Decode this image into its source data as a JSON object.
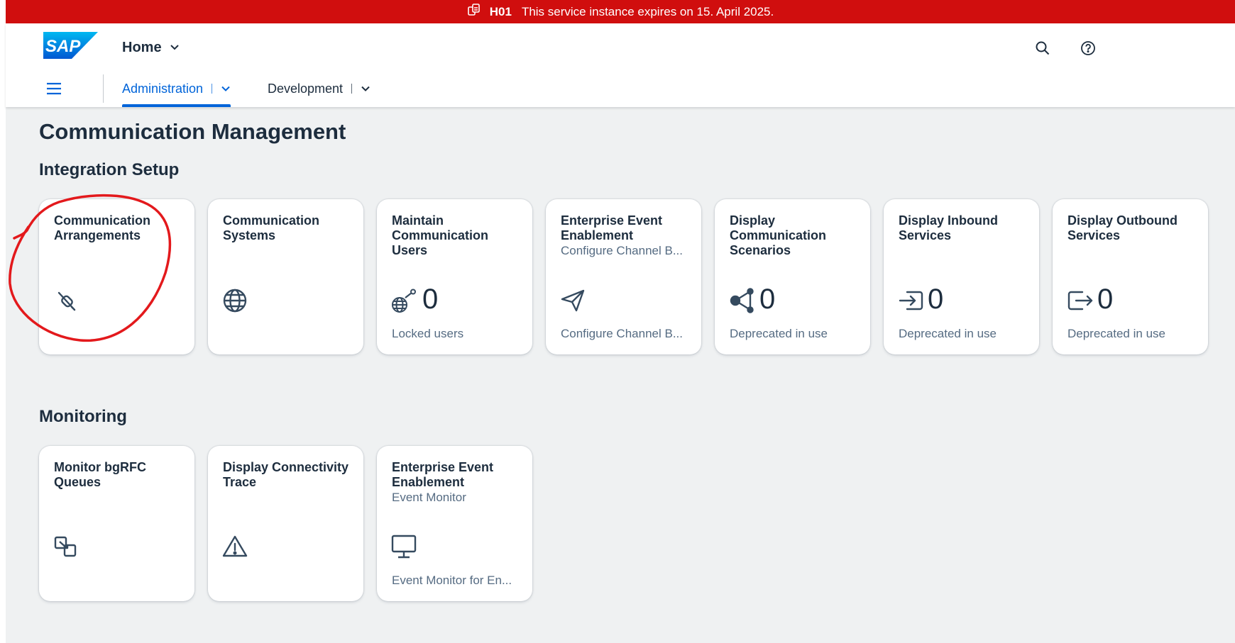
{
  "banner": {
    "system_id": "H01",
    "message": "This service instance expires on 15. April 2025.",
    "color": "#d00e0e"
  },
  "shell": {
    "logo_text": "SAP",
    "home_label": "Home",
    "actions": [
      "search-icon",
      "help-icon"
    ],
    "nav_tabs": [
      {
        "label": "Administration",
        "active": true
      },
      {
        "label": "Development",
        "active": false
      }
    ],
    "accent_color": "#0064d9"
  },
  "page": {
    "title": "Communication Management"
  },
  "sections": [
    {
      "title": "Integration Setup",
      "tiles": [
        {
          "title": "Communication Arrangements",
          "subtitle": "",
          "icon": "disconnected-icon",
          "number": "",
          "footer": ""
        },
        {
          "title": "Communication Systems",
          "subtitle": "",
          "icon": "globe-icon",
          "number": "",
          "footer": ""
        },
        {
          "title": "Maintain Communication Users",
          "subtitle": "",
          "icon": "user-globe-icon",
          "number": "0",
          "footer": "Locked users"
        },
        {
          "title": "Enterprise Event Enablement",
          "subtitle": "Configure Channel B...",
          "icon": "paper-plane-icon",
          "number": "",
          "footer": "Configure Channel B..."
        },
        {
          "title": "Display Communication Scenarios",
          "subtitle": "",
          "icon": "share-network-icon",
          "number": "0",
          "footer": "Deprecated in use"
        },
        {
          "title": "Display Inbound Services",
          "subtitle": "",
          "icon": "inbound-icon",
          "number": "0",
          "footer": "Deprecated in use"
        },
        {
          "title": "Display Outbound Services",
          "subtitle": "",
          "icon": "outbound-icon",
          "number": "0",
          "footer": "Deprecated in use"
        }
      ]
    },
    {
      "title": "Monitoring",
      "tiles": [
        {
          "title": "Monitor bgRFC Queues",
          "subtitle": "",
          "icon": "queue-icon",
          "number": "",
          "footer": ""
        },
        {
          "title": "Display Connectivity Trace",
          "subtitle": "",
          "icon": "warning-icon",
          "number": "",
          "footer": ""
        },
        {
          "title": "Enterprise Event Enablement",
          "subtitle": "Event Monitor",
          "icon": "monitor-icon",
          "number": "",
          "footer": "Event Monitor for En..."
        }
      ]
    }
  ],
  "annotation": {
    "color": "#e3191c"
  }
}
